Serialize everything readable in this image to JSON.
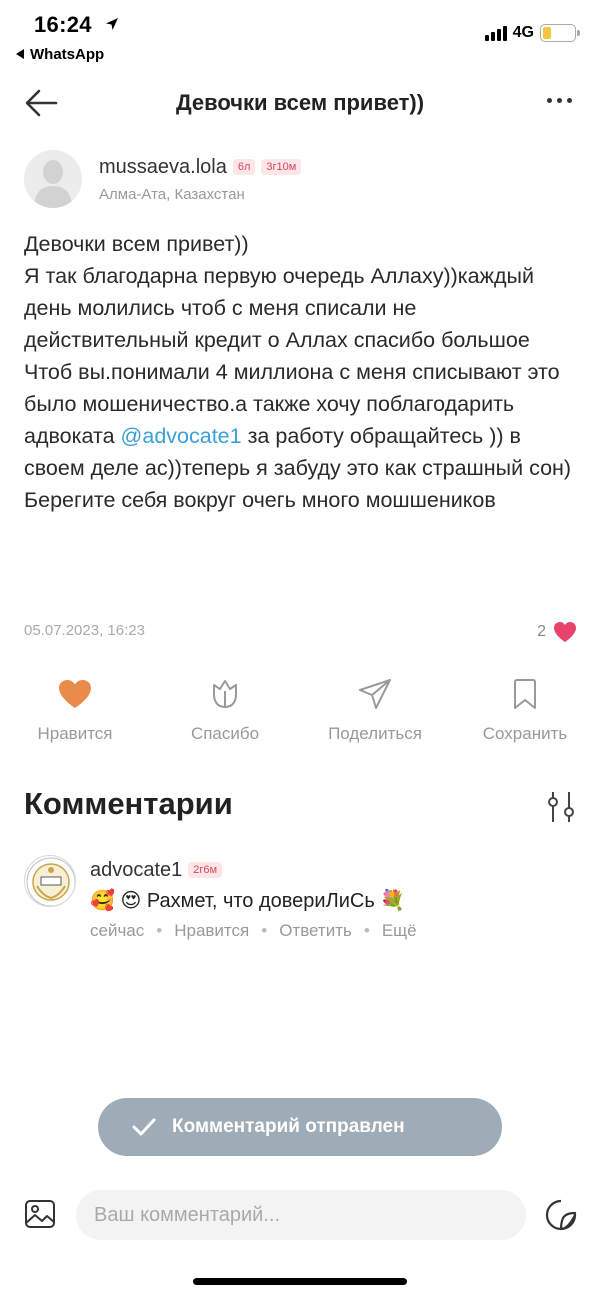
{
  "status_bar": {
    "time": "16:24",
    "back_app": "WhatsApp",
    "network": "4G",
    "battery_level": 0.25,
    "battery_color": "#f5c542"
  },
  "nav": {
    "title": "Девочки всем привет))",
    "back_icon": "arrow-left-icon",
    "more_icon": "more-dots-icon"
  },
  "post": {
    "author": {
      "name": "mussaeva.lola",
      "badge_age": "6л",
      "badge_time": "3г10м",
      "location": "Алма-Ата, Казахстан"
    },
    "text_before_mention": "Девочки всем привет))\nЯ так благодарна  первую очередь Аллаху))каждый  день молились чтоб с меня списали не действительный кредит о Аллах спасибо большое\nЧтоб вы.понимали 4 миллиона с меня списывают это было мошеничество.а также хочу поблагодарить адвоката ",
    "mention": "@advocate1",
    "text_after_mention": " за работу обращайтесь )) в своем деле ас))теперь я забуду это как страшный  сон)\nБерегите себя вокруг очегь много мошшеников",
    "date": "05.07.2023, 16:23",
    "likes_count": "2",
    "accent_color": "#e9ac7e",
    "heart_color": "#e8436a"
  },
  "actions": [
    {
      "label": "Нравится",
      "icon": "heart-icon"
    },
    {
      "label": "Спасибо",
      "icon": "tulip-icon"
    },
    {
      "label": "Поделиться",
      "icon": "share-icon"
    },
    {
      "label": "Сохранить",
      "icon": "bookmark-icon"
    }
  ],
  "comments": {
    "title": "Комментарии",
    "filter_icon": "sliders-icon",
    "items": [
      {
        "name": "advocate1",
        "badge": "2г6м",
        "emoji_prefix": "🥰 😍",
        "text": "Рахмет, что довериЛиСь",
        "emoji_suffix": "💐",
        "time": "сейчас",
        "like_label": "Нравится",
        "reply_label": "Ответить",
        "more_label": "Ещё"
      }
    ]
  },
  "toast": {
    "text": "Комментарий отправлен",
    "background": "#9eacb7"
  },
  "composer": {
    "placeholder": "Ваш комментарий...",
    "gallery_icon": "image-icon",
    "sticker_icon": "sticker-icon"
  }
}
